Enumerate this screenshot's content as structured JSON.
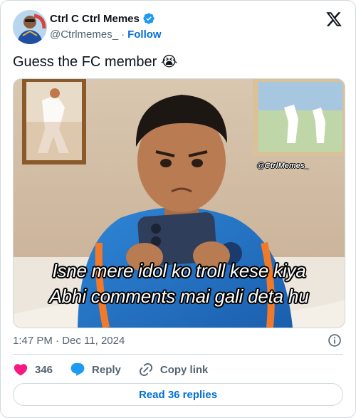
{
  "author": {
    "display_name": "Ctrl C Ctrl Memes",
    "handle": "@Ctrlmemes_",
    "separator": "·",
    "follow_label": "Follow",
    "verified": true,
    "verified_color": "#1d9bf0"
  },
  "tweet": {
    "text": "Guess the FC member",
    "emoji": "😭"
  },
  "media": {
    "watermark": "@CtrlMemes_",
    "caption_line1": "Isne mere idol ko troll kese kiya",
    "caption_line2": "Abhi comments mai gali deta hu"
  },
  "meta": {
    "timestamp": "1:47 PM · Dec 11, 2024"
  },
  "actions": {
    "like_count": "346",
    "reply_label": "Reply",
    "copy_label": "Copy link",
    "like_color": "#f91880",
    "reply_color": "#1d9bf0"
  },
  "footer": {
    "read_replies_label": "Read 36 replies"
  },
  "colors": {
    "link": "#006fd6",
    "muted": "#536471",
    "border": "#cfd9de"
  }
}
